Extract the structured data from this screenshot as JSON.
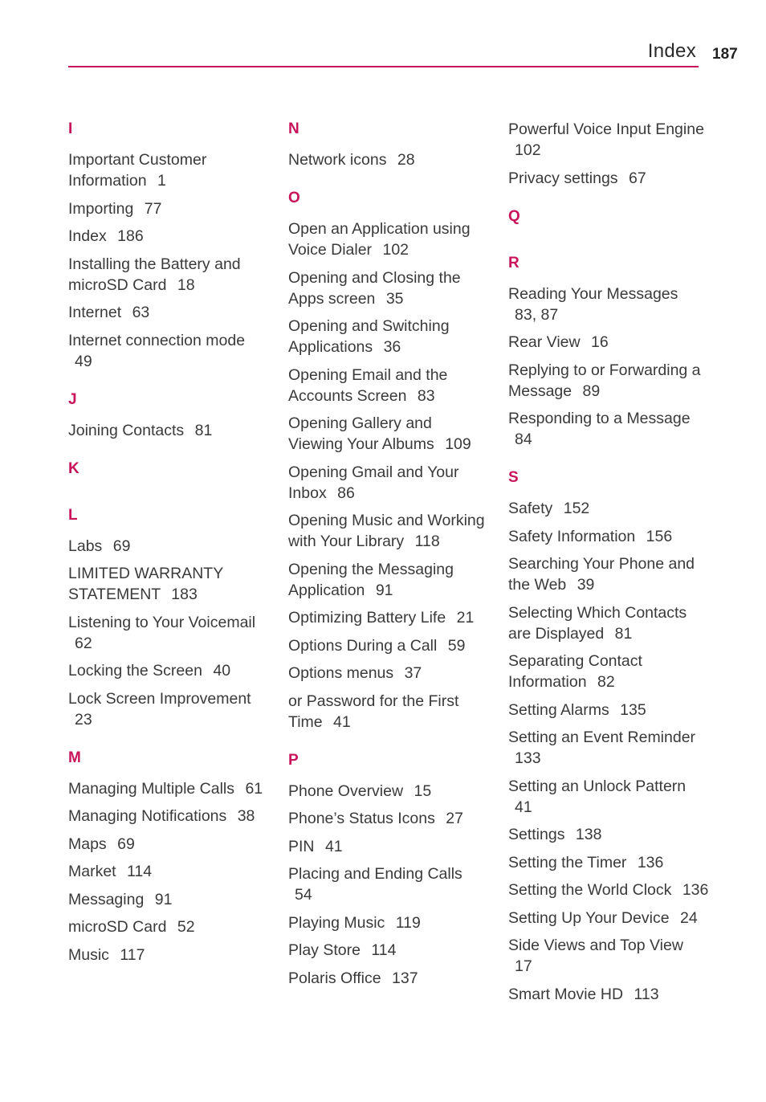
{
  "header": {
    "title": "Index",
    "page_number": "187",
    "accent_color": "#c8145a"
  },
  "columns": [
    {
      "sections": [
        {
          "letter": "I",
          "entries": [
            {
              "text": "Important Customer Information",
              "page": "1"
            },
            {
              "text": "Importing",
              "page": "77"
            },
            {
              "text": "Index",
              "page": "186"
            },
            {
              "text": "Installing the Battery and microSD Card",
              "page": "18"
            },
            {
              "text": "Internet",
              "page": "63"
            },
            {
              "text": "Internet connection mode",
              "page": "49"
            }
          ]
        },
        {
          "letter": "J",
          "entries": [
            {
              "text": "Joining Contacts",
              "page": "81"
            }
          ]
        },
        {
          "letter": "K",
          "entries": []
        },
        {
          "letter": "L",
          "entries": [
            {
              "text": "Labs",
              "page": "69"
            },
            {
              "text": "LIMITED WARRANTY STATEMENT",
              "page": "183"
            },
            {
              "text": "Listening to Your Voicemail",
              "page": "62"
            },
            {
              "text": "Locking the Screen",
              "page": "40"
            },
            {
              "text": "Lock Screen Improvement",
              "page": "23"
            }
          ]
        },
        {
          "letter": "M",
          "entries": [
            {
              "text": "Managing Multiple Calls",
              "page": "61"
            },
            {
              "text": "Managing Notifications",
              "page": "38"
            },
            {
              "text": "Maps",
              "page": "69"
            },
            {
              "text": "Market",
              "page": "114"
            },
            {
              "text": "Messaging",
              "page": "91"
            },
            {
              "text": "microSD Card",
              "page": "52"
            },
            {
              "text": "Music",
              "page": "117"
            }
          ]
        }
      ]
    },
    {
      "sections": [
        {
          "letter": "N",
          "entries": [
            {
              "text": "Network icons",
              "page": "28"
            }
          ]
        },
        {
          "letter": "O",
          "entries": [
            {
              "text": "Open an Application using Voice Dialer",
              "page": "102"
            },
            {
              "text": "Opening and Closing the Apps screen",
              "page": "35"
            },
            {
              "text": "Opening and Switching Applications",
              "page": "36"
            },
            {
              "text": "Opening Email and the Accounts Screen",
              "page": "83"
            },
            {
              "text": "Opening Gallery and Viewing Your Albums",
              "page": "109"
            },
            {
              "text": "Opening Gmail and Your Inbox",
              "page": "86"
            },
            {
              "text": "Opening Music and Working with Your Library",
              "page": "118"
            },
            {
              "text": "Opening the Messaging Application",
              "page": "91"
            },
            {
              "text": "Optimizing Battery Life",
              "page": "21"
            },
            {
              "text": "Options During a Call",
              "page": "59"
            },
            {
              "text": "Options menus",
              "page": "37"
            },
            {
              "text": "or Password for the First Time",
              "page": "41"
            }
          ]
        },
        {
          "letter": "P",
          "entries": [
            {
              "text": "Phone Overview",
              "page": "15"
            },
            {
              "text": "Phone’s Status Icons",
              "page": "27"
            },
            {
              "text": "PIN",
              "page": "41"
            },
            {
              "text": "Placing and Ending Calls",
              "page": "54"
            },
            {
              "text": "Playing Music",
              "page": "119"
            },
            {
              "text": "Play Store",
              "page": "114"
            },
            {
              "text": "Polaris Office",
              "page": "137"
            }
          ]
        }
      ]
    },
    {
      "sections": [
        {
          "letter": "",
          "entries": [
            {
              "text": "Powerful Voice Input Engine",
              "page": "102"
            },
            {
              "text": "Privacy settings",
              "page": "67"
            }
          ]
        },
        {
          "letter": "Q",
          "entries": []
        },
        {
          "letter": "R",
          "entries": [
            {
              "text": "Reading Your Messages",
              "page": "83, 87"
            },
            {
              "text": "Rear View",
              "page": "16"
            },
            {
              "text": "Replying to or Forwarding a Message",
              "page": "89"
            },
            {
              "text": "Responding to a Message",
              "page": "84"
            }
          ]
        },
        {
          "letter": "S",
          "entries": [
            {
              "text": "Safety",
              "page": "152"
            },
            {
              "text": "Safety Information",
              "page": "156"
            },
            {
              "text": "Searching Your Phone and the Web",
              "page": "39"
            },
            {
              "text": "Selecting Which Contacts are Displayed",
              "page": "81"
            },
            {
              "text": "Separating Contact Information",
              "page": "82"
            },
            {
              "text": "Setting Alarms",
              "page": "135"
            },
            {
              "text": "Setting an Event Reminder",
              "page": "133"
            },
            {
              "text": "Setting an Unlock Pattern",
              "page": "41"
            },
            {
              "text": "Settings",
              "page": "138"
            },
            {
              "text": "Setting the Timer",
              "page": "136"
            },
            {
              "text": "Setting the World Clock",
              "page": "136"
            },
            {
              "text": "Setting Up Your Device",
              "page": "24"
            },
            {
              "text": "Side Views and Top View",
              "page": "17"
            },
            {
              "text": "Smart Movie HD",
              "page": "113"
            }
          ]
        }
      ]
    }
  ]
}
